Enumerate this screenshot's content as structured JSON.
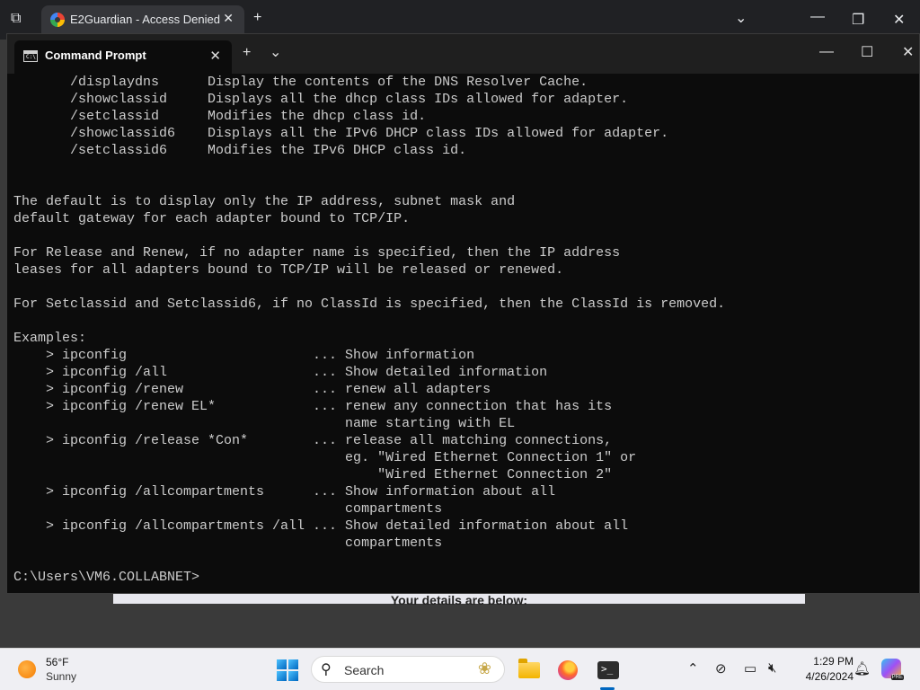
{
  "browser": {
    "tab_title": "E2Guardian - Access Denied",
    "tab_close": "✕",
    "new_tab": "+",
    "dropdown": "⌄",
    "minimize": "—",
    "restore": "❐",
    "close": "✕",
    "page_peek_text": "Your details are below:"
  },
  "terminal": {
    "tab_title": "Command Prompt",
    "tab_close": "✕",
    "new_tab": "+",
    "dropdown": "⌄",
    "minimize": "—",
    "maximize": "☐",
    "close": "✕",
    "lines": [
      "       /displaydns      Display the contents of the DNS Resolver Cache.",
      "       /showclassid     Displays all the dhcp class IDs allowed for adapter.",
      "       /setclassid      Modifies the dhcp class id.",
      "       /showclassid6    Displays all the IPv6 DHCP class IDs allowed for adapter.",
      "       /setclassid6     Modifies the IPv6 DHCP class id.",
      "",
      "",
      "The default is to display only the IP address, subnet mask and",
      "default gateway for each adapter bound to TCP/IP.",
      "",
      "For Release and Renew, if no adapter name is specified, then the IP address",
      "leases for all adapters bound to TCP/IP will be released or renewed.",
      "",
      "For Setclassid and Setclassid6, if no ClassId is specified, then the ClassId is removed.",
      "",
      "Examples:",
      "    > ipconfig                       ... Show information",
      "    > ipconfig /all                  ... Show detailed information",
      "    > ipconfig /renew                ... renew all adapters",
      "    > ipconfig /renew EL*            ... renew any connection that has its",
      "                                         name starting with EL",
      "    > ipconfig /release *Con*        ... release all matching connections,",
      "                                         eg. \"Wired Ethernet Connection 1\" or",
      "                                             \"Wired Ethernet Connection 2\"",
      "    > ipconfig /allcompartments      ... Show information about all",
      "                                         compartments",
      "    > ipconfig /allcompartments /all ... Show detailed information about all",
      "                                         compartments",
      "",
      "C:\\Users\\VM6.COLLABNET>"
    ]
  },
  "taskbar": {
    "weather_temp": "56°F",
    "weather_cond": "Sunny",
    "search_label": "Search",
    "search_icon": "⚲",
    "tray_chevron": "⌃",
    "time": "1:29 PM",
    "date": "4/26/2024",
    "copilot_badge": "PRE"
  },
  "icons": {
    "tab_actions": "tab-actions-icon",
    "chrome_favicon": "google-icon",
    "cmd": "command-prompt-icon",
    "start": "windows-start-icon",
    "explorer": "file-explorer-icon",
    "firefox": "firefox-icon",
    "terminal": "terminal-icon",
    "network": "network-offline-icon",
    "display": "display-icon",
    "volume": "volume-icon",
    "bell": "notification-bell-icon",
    "copilot": "copilot-icon"
  },
  "colors": {
    "console_bg": "#0c0c0c",
    "console_text": "#cccccc",
    "taskbar_bg": "#efeff3",
    "accent": "#0067c0"
  }
}
